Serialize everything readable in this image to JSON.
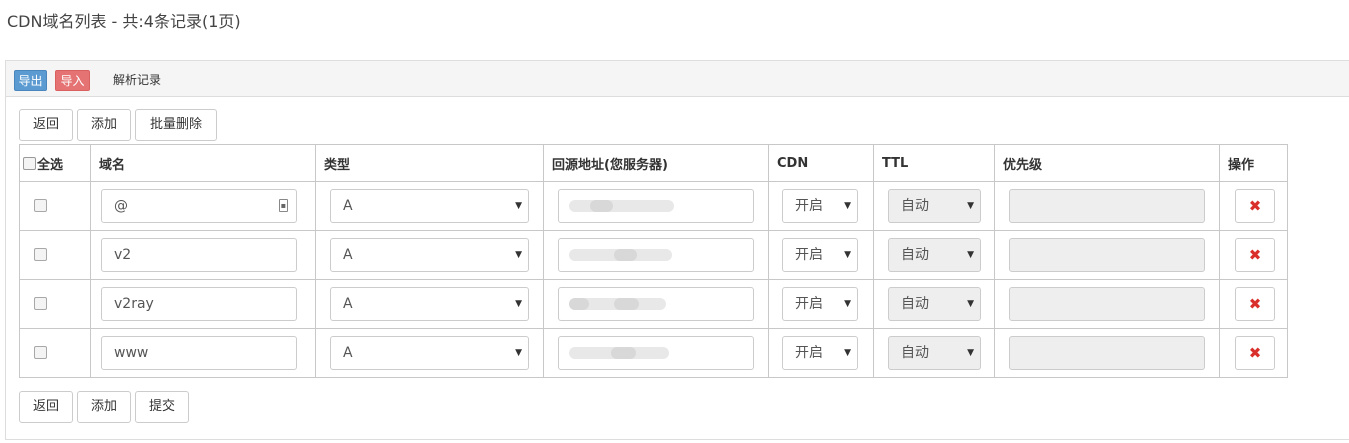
{
  "page": {
    "title": "CDN域名列表 - 共:4条记录(1页)"
  },
  "toolbar": {
    "export_label": "导出",
    "import_label": "导入",
    "tab_label": "解析记录"
  },
  "top_actions": {
    "back": "返回",
    "add": "添加",
    "batch_delete": "批量删除"
  },
  "table": {
    "headers": {
      "select_all": "全选",
      "domain": "域名",
      "type": "类型",
      "origin": "回源地址(您服务器)",
      "cdn": "CDN",
      "ttl": "TTL",
      "priority": "优先级",
      "actions": "操作"
    },
    "rows": [
      {
        "domain": "@",
        "type": "A",
        "cdn": "开启",
        "ttl": "自动"
      },
      {
        "domain": "v2",
        "type": "A",
        "cdn": "开启",
        "ttl": "自动"
      },
      {
        "domain": "v2ray",
        "type": "A",
        "cdn": "开启",
        "ttl": "自动"
      },
      {
        "domain": "www",
        "type": "A",
        "cdn": "开启",
        "ttl": "自动"
      }
    ],
    "delete_icon": "times-icon"
  },
  "bottom_actions": {
    "back": "返回",
    "add": "添加",
    "submit": "提交"
  },
  "colors": {
    "export_btn": "#5b9bd1",
    "import_btn": "#e57373",
    "delete_icon": "#d9302c"
  }
}
